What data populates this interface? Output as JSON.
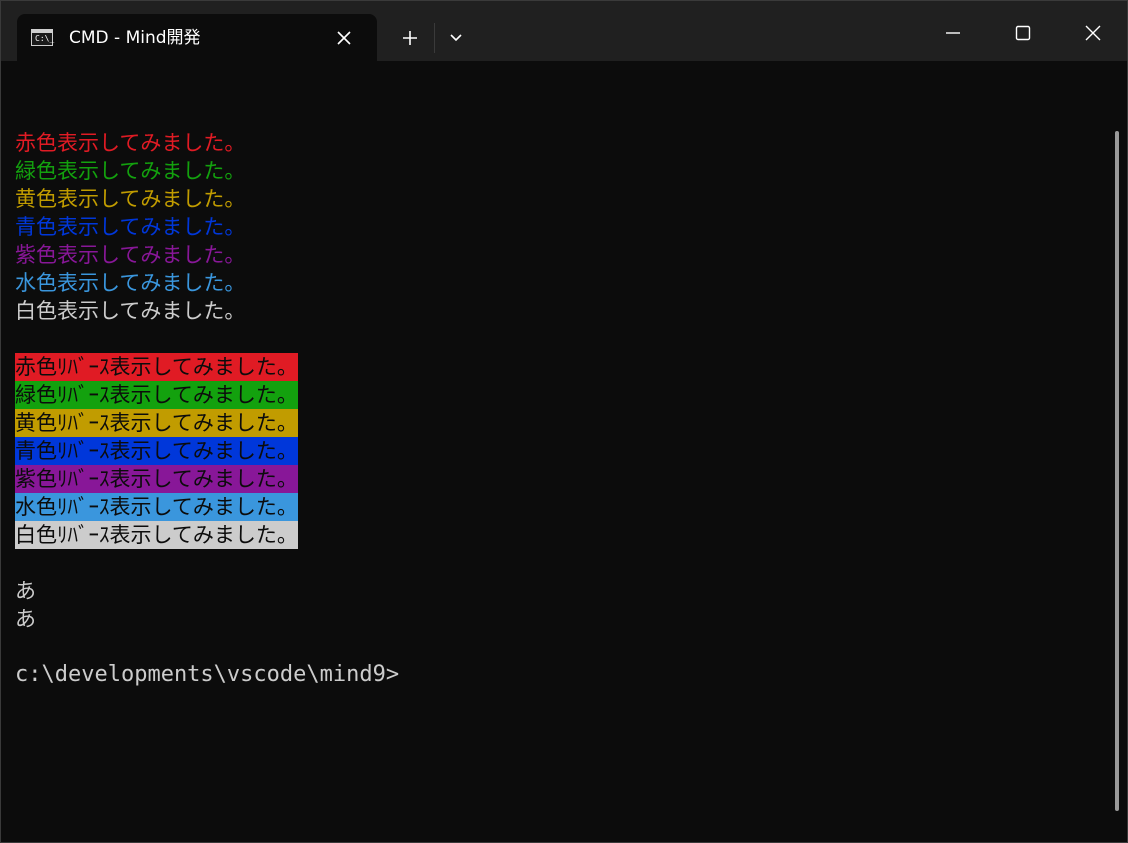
{
  "tab": {
    "icon": "terminal-icon",
    "icon_glyph": "C:\\_",
    "title": "CMD - Mind開発"
  },
  "titlebar": {
    "new_tab_icon": "plus-icon",
    "dropdown_icon": "chevron-down-icon",
    "minimize_icon": "minimize-icon",
    "maximize_icon": "maximize-icon",
    "close_icon": "close-icon"
  },
  "console": {
    "colors": {
      "red": "#e01b24",
      "green": "#13a10e",
      "yellow": "#c19c00",
      "blue": "#0037da",
      "purple": "#881798",
      "cyan": "#3a96dd",
      "white": "#cccccc",
      "background": "#0c0c0c"
    },
    "colored_lines": [
      "赤色表示してみました。",
      "緑色表示してみました。",
      "黄色表示してみました。",
      "青色表示してみました。",
      "紫色表示してみました。",
      "水色表示してみました。",
      "白色表示してみました。"
    ],
    "reverse_lines": [
      "赤色ﾘﾊﾞｰｽ表示してみました。",
      "緑色ﾘﾊﾞｰｽ表示してみました。",
      "黄色ﾘﾊﾞｰｽ表示してみました。",
      "青色ﾘﾊﾞｰｽ表示してみました。",
      "紫色ﾘﾊﾞｰｽ表示してみました。",
      "水色ﾘﾊﾞｰｽ表示してみました。",
      "白色ﾘﾊﾞｰｽ表示してみました。"
    ],
    "echo_lines": [
      "あ",
      "あ"
    ],
    "prompt": "c:\\developments\\vscode\\mind9>"
  }
}
